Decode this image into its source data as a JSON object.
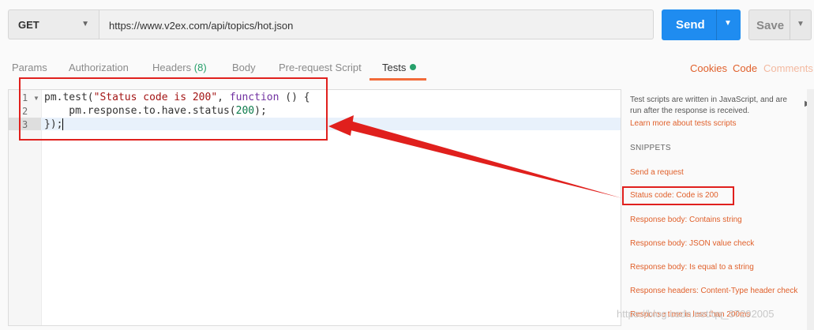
{
  "request": {
    "method": "GET",
    "url": "https://www.v2ex.com/api/topics/hot.json",
    "send_label": "Send",
    "save_label": "Save"
  },
  "tabs": {
    "params": "Params",
    "authorization": "Authorization",
    "headers": "Headers",
    "headers_count": "(8)",
    "body": "Body",
    "prerequest": "Pre-request Script",
    "tests": "Tests"
  },
  "toplinks": {
    "cookies": "Cookies",
    "code": "Code",
    "comments": "Comments"
  },
  "editor": {
    "line_numbers": [
      "1",
      "2",
      "3"
    ]
  },
  "side": {
    "description": "Test scripts are written in JavaScript, and are run after the response is received.",
    "learn_more": "Learn more about tests scripts",
    "snippets_heading": "SNIPPETS",
    "snippets": [
      "Send a request",
      "Status code: Code is 200",
      "Response body: Contains string",
      "Response body: JSON value check",
      "Response body: Is equal to a string",
      "Response headers: Content-Type header check",
      "Response time is less than 200ms"
    ]
  },
  "watermark": "https://blog.csdn.net/qq_37292005",
  "colors": {
    "accent": "#f26b3a",
    "send": "#1f8cf0",
    "annotation": "#e0201d",
    "success": "#27a06b"
  }
}
